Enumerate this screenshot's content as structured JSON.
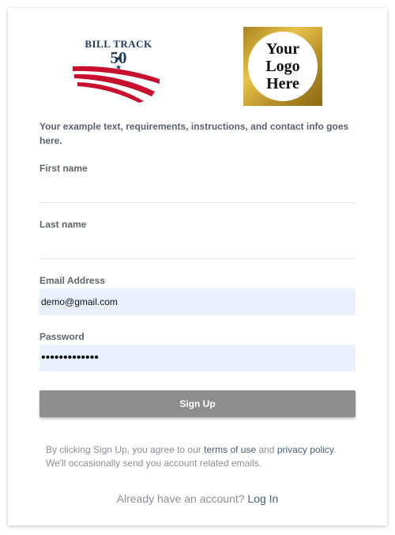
{
  "logos": {
    "billtrack": {
      "line1": "BILL TRACK",
      "number": "50",
      "stars": "★ ★"
    },
    "placeholder": {
      "text": "Your Logo Here"
    }
  },
  "intro_text": "Your example text, requirements, instructions, and contact info goes here.",
  "form": {
    "first_name": {
      "label": "First name",
      "value": ""
    },
    "last_name": {
      "label": "Last name",
      "value": ""
    },
    "email": {
      "label": "Email Address",
      "value": "demo@gmail.com"
    },
    "password": {
      "label": "Password",
      "value": "•••••••••••••"
    }
  },
  "signup_button": "Sign Up",
  "terms": {
    "prefix": "By clicking Sign Up, you agree to our ",
    "terms_link": "terms of use",
    "middle": " and ",
    "privacy_link": "privacy policy",
    "suffix": ". We'll occasionally send you account related emails."
  },
  "login": {
    "prompt": "Already have an account? ",
    "link": "Log In"
  },
  "colors": {
    "brand_navy": "#1f3a5f",
    "brand_red": "#c8102e",
    "autofill_bg": "#e8f0fe",
    "button_gray": "#8b8d8f",
    "link": "#4b5c79"
  }
}
